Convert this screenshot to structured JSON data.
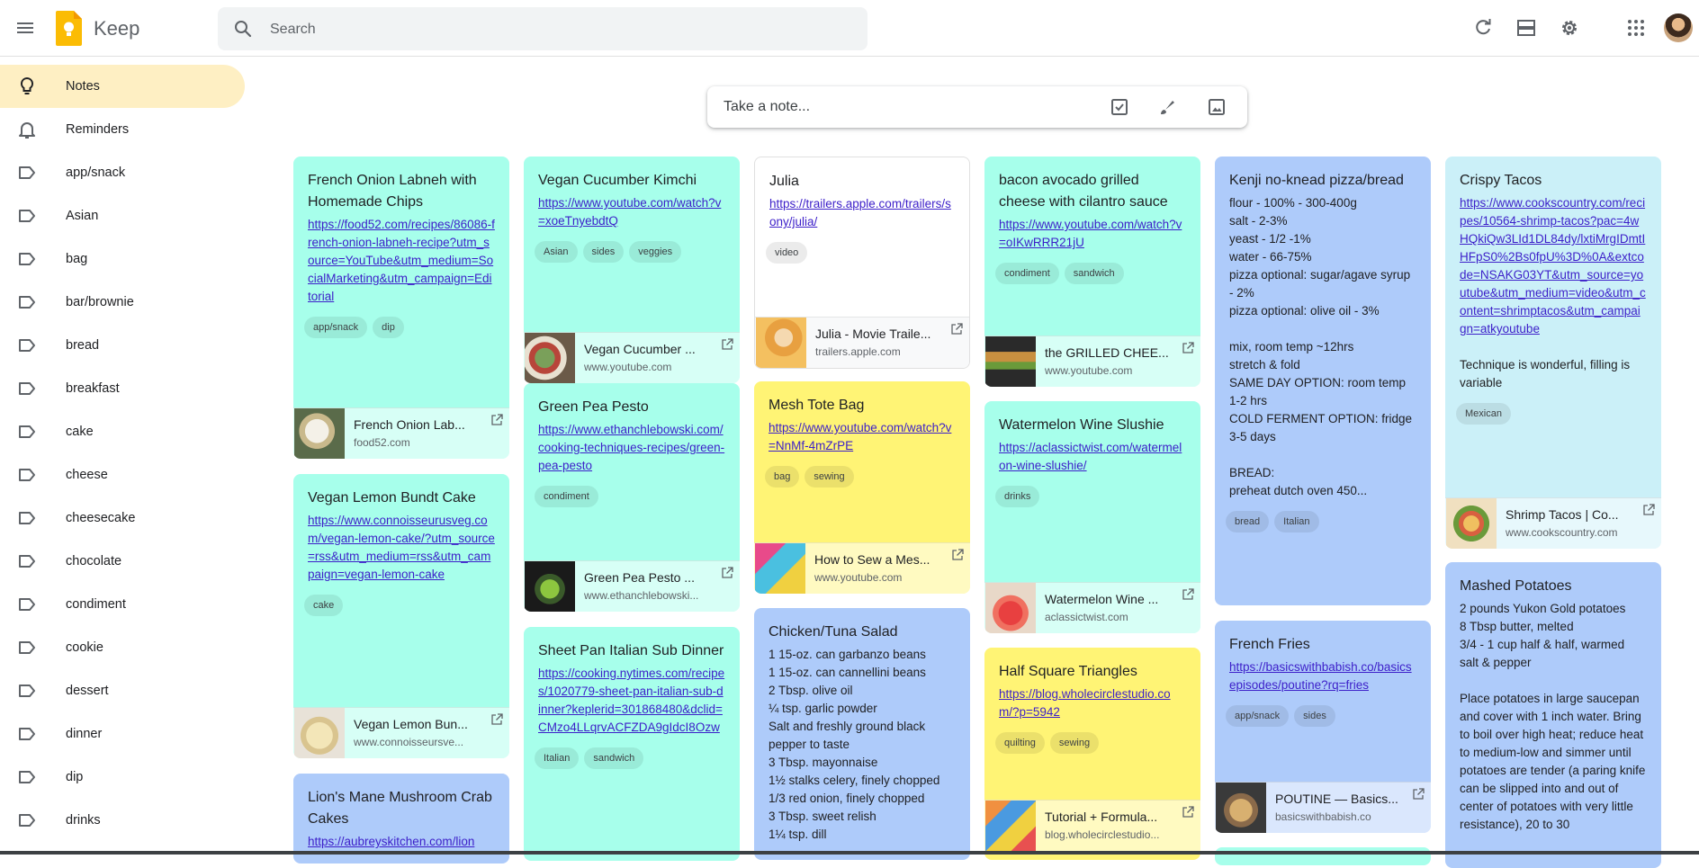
{
  "app": {
    "title": "Keep"
  },
  "search": {
    "placeholder": "Search"
  },
  "take_note": {
    "placeholder": "Take a note..."
  },
  "sidebar": {
    "items": [
      {
        "label": "Notes",
        "icon": "lightbulb-icon"
      },
      {
        "label": "Reminders",
        "icon": "bell-icon"
      },
      {
        "label": "app/snack",
        "icon": "label-icon"
      },
      {
        "label": "Asian",
        "icon": "label-icon"
      },
      {
        "label": "bag",
        "icon": "label-icon"
      },
      {
        "label": "bar/brownie",
        "icon": "label-icon"
      },
      {
        "label": "bread",
        "icon": "label-icon"
      },
      {
        "label": "breakfast",
        "icon": "label-icon"
      },
      {
        "label": "cake",
        "icon": "label-icon"
      },
      {
        "label": "cheese",
        "icon": "label-icon"
      },
      {
        "label": "cheesecake",
        "icon": "label-icon"
      },
      {
        "label": "chocolate",
        "icon": "label-icon"
      },
      {
        "label": "condiment",
        "icon": "label-icon"
      },
      {
        "label": "cookie",
        "icon": "label-icon"
      },
      {
        "label": "dessert",
        "icon": "label-icon"
      },
      {
        "label": "dinner",
        "icon": "label-icon"
      },
      {
        "label": "dip",
        "icon": "label-icon"
      },
      {
        "label": "drinks",
        "icon": "label-icon"
      }
    ]
  },
  "colors": {
    "teal": "#a7ffeb",
    "blue": "#aecbfa",
    "yellow": "#fff475",
    "cyan": "#cbf0f8",
    "active_nav": "#feefc3",
    "link": "#3c1fc9"
  },
  "notes": {
    "n1": {
      "title": "French Onion Labneh with Homemade Chips",
      "link": "https://food52.com/recipes/86086-french-onion-labneh-recipe?utm_source=YouTube&utm_medium=SocialMarketing&utm_campaign=Editorial",
      "labels": [
        "app/snack",
        "dip"
      ],
      "preview": {
        "title": "French Onion Lab...",
        "domain": "food52.com"
      }
    },
    "n2": {
      "title": "Vegan Lemon Bundt Cake",
      "link": "https://www.connoisseurusveg.com/vegan-lemon-cake/?utm_source=rss&utm_medium=rss&utm_campaign=vegan-lemon-cake",
      "labels": [
        "cake"
      ],
      "preview": {
        "title": "Vegan Lemon Bun...",
        "domain": "www.connoisseursve..."
      }
    },
    "n3": {
      "title": "Lion's Mane Mushroom Crab Cakes",
      "link": "https://aubreyskitchen.com/lion"
    },
    "n4": {
      "title": "Vegan Cucumber Kimchi",
      "link": "https://www.youtube.com/watch?v=xoeTnyebdtQ",
      "labels": [
        "Asian",
        "sides",
        "veggies"
      ],
      "preview": {
        "title": "Vegan Cucumber ...",
        "domain": "www.youtube.com"
      }
    },
    "n5": {
      "title": "Green Pea Pesto",
      "link": "https://www.ethanchlebowski.com/cooking-techniques-recipes/green-pea-pesto",
      "labels": [
        "condiment"
      ],
      "preview": {
        "title": "Green Pea Pesto ...",
        "domain": "www.ethanchlebowski..."
      }
    },
    "n6": {
      "title": "Sheet Pan Italian Sub Dinner",
      "link": "https://cooking.nytimes.com/recipes/1020779-sheet-pan-italian-sub-dinner?keplerid=301868480&dclid=CMzo4LLqrvACFZDA9gIdcI8Ozw",
      "labels": [
        "Italian",
        "sandwich"
      ]
    },
    "n7": {
      "title": "Julia",
      "link": "https://trailers.apple.com/trailers/sony/julia/",
      "labels": [
        "video"
      ],
      "preview": {
        "title": "Julia - Movie Traile...",
        "domain": "trailers.apple.com"
      }
    },
    "n8": {
      "title": "Mesh Tote Bag",
      "link": "https://www.youtube.com/watch?v=NnMf-4mZrPE",
      "labels": [
        "bag",
        "sewing"
      ],
      "preview": {
        "title": "How to Sew a Mes...",
        "domain": "www.youtube.com"
      }
    },
    "n9": {
      "title": "Chicken/Tuna Salad",
      "body": "1 15-oz. can garbanzo beans\n1 15-oz. can cannellini beans\n2 Tbsp. olive oil\n¼ tsp. garlic powder\nSalt and freshly ground black pepper to taste\n3 Tbsp. mayonnaise\n1½ stalks celery, finely chopped\n1/3 red onion, finely chopped\n3 Tbsp. sweet relish\n1¼ tsp. dill"
    },
    "n10": {
      "title": "bacon avocado grilled cheese with cilantro sauce",
      "link": "https://www.youtube.com/watch?v=oIKwRRR21jU",
      "labels": [
        "condiment",
        "sandwich"
      ],
      "preview": {
        "title": "the GRILLED CHEE...",
        "domain": "www.youtube.com"
      }
    },
    "n11": {
      "title": "Watermelon Wine Slushie",
      "link": "https://aclassictwist.com/watermelon-wine-slushie/",
      "labels": [
        "drinks"
      ],
      "preview": {
        "title": "Watermelon Wine ...",
        "domain": "aclassictwist.com"
      }
    },
    "n12": {
      "title": "Half Square Triangles",
      "link": "https://blog.wholecirclestudio.com/?p=5942",
      "labels": [
        "quilting",
        "sewing"
      ],
      "preview": {
        "title": "Tutorial + Formula...",
        "domain": "blog.wholecirclestudio..."
      }
    },
    "n13": {
      "title": "Kenji no-knead pizza/bread",
      "body": "flour - 100% - 300-400g\nsalt - 2-3%\nyeast - 1/2 -1%\nwater - 66-75%\npizza optional: sugar/agave syrup - 2%\npizza optional: olive oil - 3%\n\nmix, room temp ~12hrs\nstretch & fold\nSAME DAY OPTION: room temp 1-2 hrs\nCOLD FERMENT OPTION: fridge 3-5 days\n\nBREAD:\npreheat dutch oven 450...",
      "labels": [
        "bread",
        "Italian"
      ]
    },
    "n14": {
      "title": "French Fries",
      "link": "https://basicswithbabish.co/basicsepisodes/poutine?rq=fries",
      "labels": [
        "app/snack",
        "sides"
      ],
      "preview": {
        "title": "POUTINE — Basics...",
        "domain": "basicswithbabish.co"
      }
    },
    "n15": {
      "title": "Crispy Tacos",
      "link": "https://www.cookscountry.com/recipes/10564-shrimp-tacos?pac=4wHQkiQw3LId1DL84dy/lxtiMrgIDmtIHFpS0%2Bs0fpU%3D%0A&extcode=NSAKG03YT&utm_source=youtube&utm_medium=video&utm_content=shrimptacos&utm_campaign=atkyoutube",
      "body": "Technique is wonderful, filling is variable",
      "labels": [
        "Mexican"
      ],
      "preview": {
        "title": "Shrimp Tacos | Co...",
        "domain": "www.cookscountry.com"
      }
    },
    "n16": {
      "title": "Mashed Potatoes",
      "body": "2 pounds Yukon Gold potatoes\n8 Tbsp butter, melted\n3/4 - 1 cup half & half, warmed\nsalt & pepper\n\nPlace potatoes in large saucepan and cover with 1 inch water. Bring to boil over high heat; reduce heat to medium-low and simmer until potatoes are tender (a paring knife can be slipped into and out of center of potatoes with very little resistance), 20 to 30"
    }
  }
}
